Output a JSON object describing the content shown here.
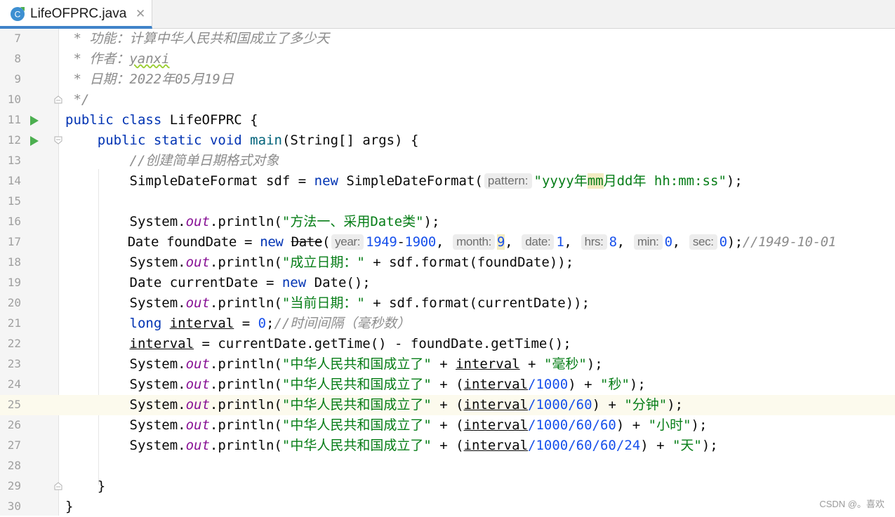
{
  "tab": {
    "title": "LifeOFPRC.java",
    "icon": "java-class-icon",
    "close_glyph": "✕"
  },
  "watermark": "CSDN @。喜欢",
  "lines": [
    {
      "num": "7",
      "doc_prefix": " * ",
      "doc_text": "功能：计算中华人民共和国成立了多少天"
    },
    {
      "num": "8",
      "doc_prefix": " * ",
      "doc_label": "作者：",
      "doc_text": "yanxi"
    },
    {
      "num": "9",
      "doc_prefix": " * ",
      "doc_label": "日期：",
      "doc_text": "2022年05月19日"
    },
    {
      "num": "10",
      "doc_end": " */"
    },
    {
      "num": "11",
      "kw1": "public",
      "kw2": "class",
      "name": "LifeOFPRC",
      "rest": " {"
    },
    {
      "num": "12",
      "kw1": "public",
      "kw2": "static",
      "kw3": "void",
      "name": "main",
      "rest": "(String[] args) {"
    },
    {
      "num": "13",
      "comment": "//创建简单日期格式对象"
    },
    {
      "num": "14",
      "t1": "SimpleDateFormat sdf = ",
      "kw": "new",
      "t2": " SimpleDateFormat(",
      "hint": "pattern:",
      "s1": "\"yyyy年",
      "s2": "mm",
      "s3": "月dd年 hh:mm:ss\"",
      "t3": ");"
    },
    {
      "num": "15"
    },
    {
      "num": "16",
      "t1": "System.",
      "field": "out",
      "t2": ".println(",
      "str": "\"方法一、采用Date类\"",
      "t3": ");"
    },
    {
      "num": "17",
      "t1": "Date foundDate = ",
      "kw": "new",
      "cls": "Date",
      "t2": "(",
      "h1": "year:",
      "n1": "1949",
      "op": "-",
      "n2": "1900",
      "h2": "month:",
      "n3": "9",
      "h3": "date:",
      "n4": "1",
      "h4": "hrs:",
      "n5": "8",
      "h5": "min:",
      "n6": "0",
      "h6": "sec:",
      "n7": "0",
      "t3": ");",
      "comment": "//1949-10-01",
      "sep": ", "
    },
    {
      "num": "18",
      "t1": "System.",
      "field": "out",
      "t2": ".println(",
      "str": "\"成立日期：\"",
      "t3": " + sdf.format(foundDate));"
    },
    {
      "num": "19",
      "t1": "Date currentDate = ",
      "kw": "new",
      "t2": " Date();"
    },
    {
      "num": "20",
      "t1": "System.",
      "field": "out",
      "t2": ".println(",
      "str": "\"当前日期：\"",
      "t3": " + sdf.format(currentDate));"
    },
    {
      "num": "21",
      "kw": "long",
      "var": "interval",
      "t1": " = ",
      "n1": "0",
      "t2": ";",
      "comment": "//时间间隔（毫秒数）"
    },
    {
      "num": "22",
      "var": "interval",
      "t1": " = currentDate.getTime() - foundDate.getTime();"
    },
    {
      "num": "23",
      "t1": "System.",
      "field": "out",
      "t2": ".println(",
      "str": "\"中华人民共和国成立了\"",
      "t3": " + ",
      "var": "interval",
      "t4": " + ",
      "str2": "\"毫秒\"",
      "t5": ");"
    },
    {
      "num": "24",
      "t1": "System.",
      "field": "out",
      "t2": ".println(",
      "str": "\"中华人民共和国成立了\"",
      "t3": " + (",
      "var": "interval",
      "divs": "/1000",
      "t4": ") + ",
      "str2": "\"秒\"",
      "t5": ");"
    },
    {
      "num": "25",
      "t1": "System.",
      "field": "out",
      "t2": ".println(",
      "str": "\"中华人民共和国成立了\"",
      "t3": " + (",
      "var": "interval",
      "divs": "/1000/60",
      "t4": ") + ",
      "str2": "\"分钟\"",
      "t5": ");"
    },
    {
      "num": "26",
      "t1": "System.",
      "field": "out",
      "t2": ".println(",
      "str": "\"中华人民共和国成立了\"",
      "t3": " + (",
      "var": "interval",
      "divs": "/1000/60/60",
      "t4": ") + ",
      "str2": "\"小时\"",
      "t5": ");"
    },
    {
      "num": "27",
      "t1": "System.",
      "field": "out",
      "t2": ".println(",
      "str": "\"中华人民共和国成立了\"",
      "t3": " + (",
      "var": "interval",
      "divs": "/1000/60/60/24",
      "t4": ") + ",
      "str2": "\"天\"",
      "t5": ");"
    },
    {
      "num": "28"
    },
    {
      "num": "29",
      "t1": "}"
    },
    {
      "num": "30",
      "t1": "}"
    }
  ],
  "colors": {
    "keyword": "#0033b3",
    "string": "#067d17",
    "number": "#1750eb",
    "comment": "#8c8c8c",
    "static_field": "#871094",
    "run": "#4caf50",
    "tab_underline": "#4083c9"
  },
  "active_line": "25"
}
